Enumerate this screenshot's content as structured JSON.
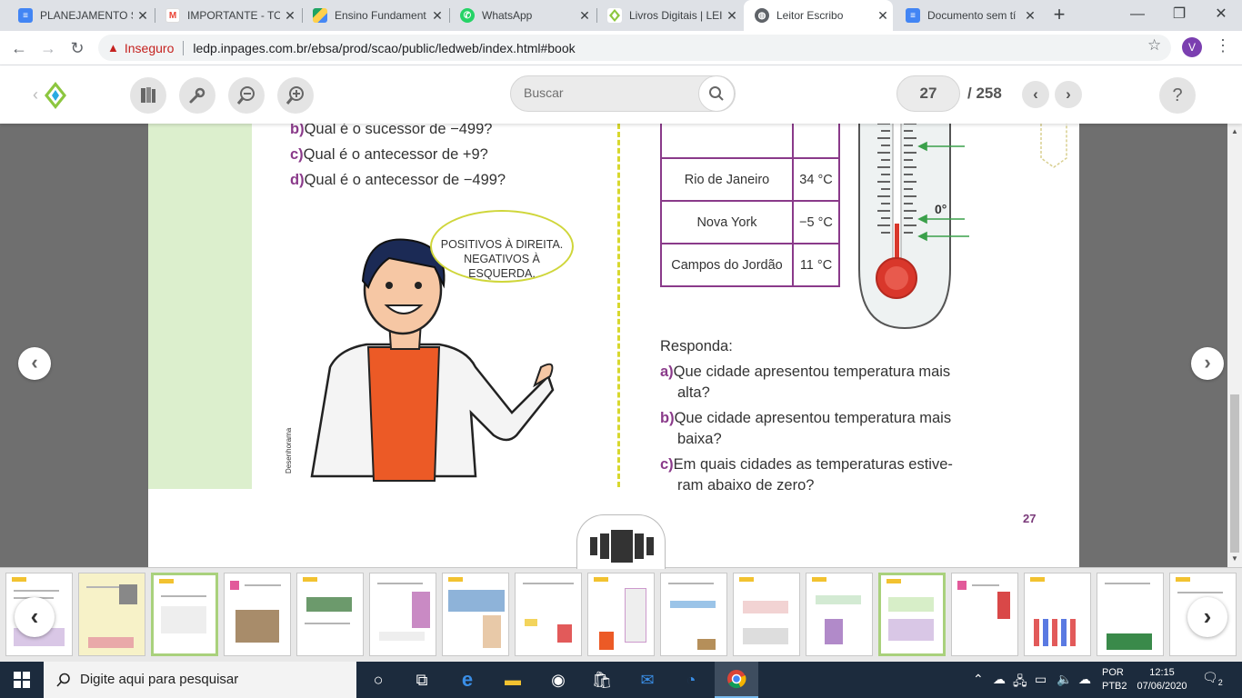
{
  "browser": {
    "tabs": [
      {
        "title": "PLANEJAMENTO S",
        "icon": "google-docs-icon",
        "color": "#4285f4"
      },
      {
        "title": "IMPORTANTE - TO",
        "icon": "gmail-icon",
        "color": "#ea4335"
      },
      {
        "title": "Ensino Fundament",
        "icon": "google-drive-icon",
        "color": "#1fa463"
      },
      {
        "title": "WhatsApp",
        "icon": "whatsapp-icon",
        "color": "#25d366"
      },
      {
        "title": "Livros Digitais | LEI",
        "icon": "ledp-icon",
        "color": "#f2c230"
      },
      {
        "title": "Leitor Escribo",
        "icon": "globe-icon",
        "color": "#5f6368"
      },
      {
        "title": "Documento sem tí",
        "icon": "google-docs-icon",
        "color": "#4285f4"
      }
    ],
    "new_tab": "+",
    "window_buttons": {
      "minimize": "—",
      "maximize": "❐",
      "close": "✕"
    },
    "address": {
      "security_label": "Inseguro",
      "url": "ledp.inpages.com.br/ebsa/prod/scao/public/ledweb/index.html#book"
    },
    "profile_initial": "V"
  },
  "toolbar": {
    "search_placeholder": "Buscar",
    "current_page": "27",
    "total_pages": "/ 258",
    "help": "?"
  },
  "book_page": {
    "left_questions": [
      {
        "letter": "b)",
        "text": "Qual é o sucessor de −499?"
      },
      {
        "letter": "c)",
        "text": "Qual é o antecessor de +9?"
      },
      {
        "letter": "d)",
        "text": "Qual é o antecessor de −499?"
      }
    ],
    "speech_bubble": [
      "POSITIVOS À DIREITA.",
      "NEGATIVOS À ESQUERDA."
    ],
    "image_credit": "Desenhorama",
    "city_table": [
      {
        "city": "",
        "temp": ""
      },
      {
        "city": "Rio de Janeiro",
        "temp": "34 °C"
      },
      {
        "city": "Nova York",
        "temp": "−5 °C"
      },
      {
        "city": "Campos do Jordão",
        "temp": "11 °C"
      }
    ],
    "thermometer_zero_label": "0°",
    "respond_heading": "Responda:",
    "right_questions": [
      {
        "letter": "a)",
        "lines": [
          "Que cidade apresentou temperatura mais",
          "alta?"
        ]
      },
      {
        "letter": "b)",
        "lines": [
          "Que cidade apresentou temperatura mais",
          "baixa?"
        ]
      },
      {
        "letter": "c)",
        "lines": [
          "Em quais cidades as temperaturas estive-",
          "ram abaixo de zero?"
        ]
      }
    ],
    "page_number": "27"
  },
  "taskbar": {
    "search_placeholder": "Digite aqui para pesquisar",
    "language": {
      "line1": "POR",
      "line2": "PTB2"
    },
    "clock": {
      "time": "12:15",
      "date": "07/06/2020"
    },
    "notification_count": "2"
  }
}
